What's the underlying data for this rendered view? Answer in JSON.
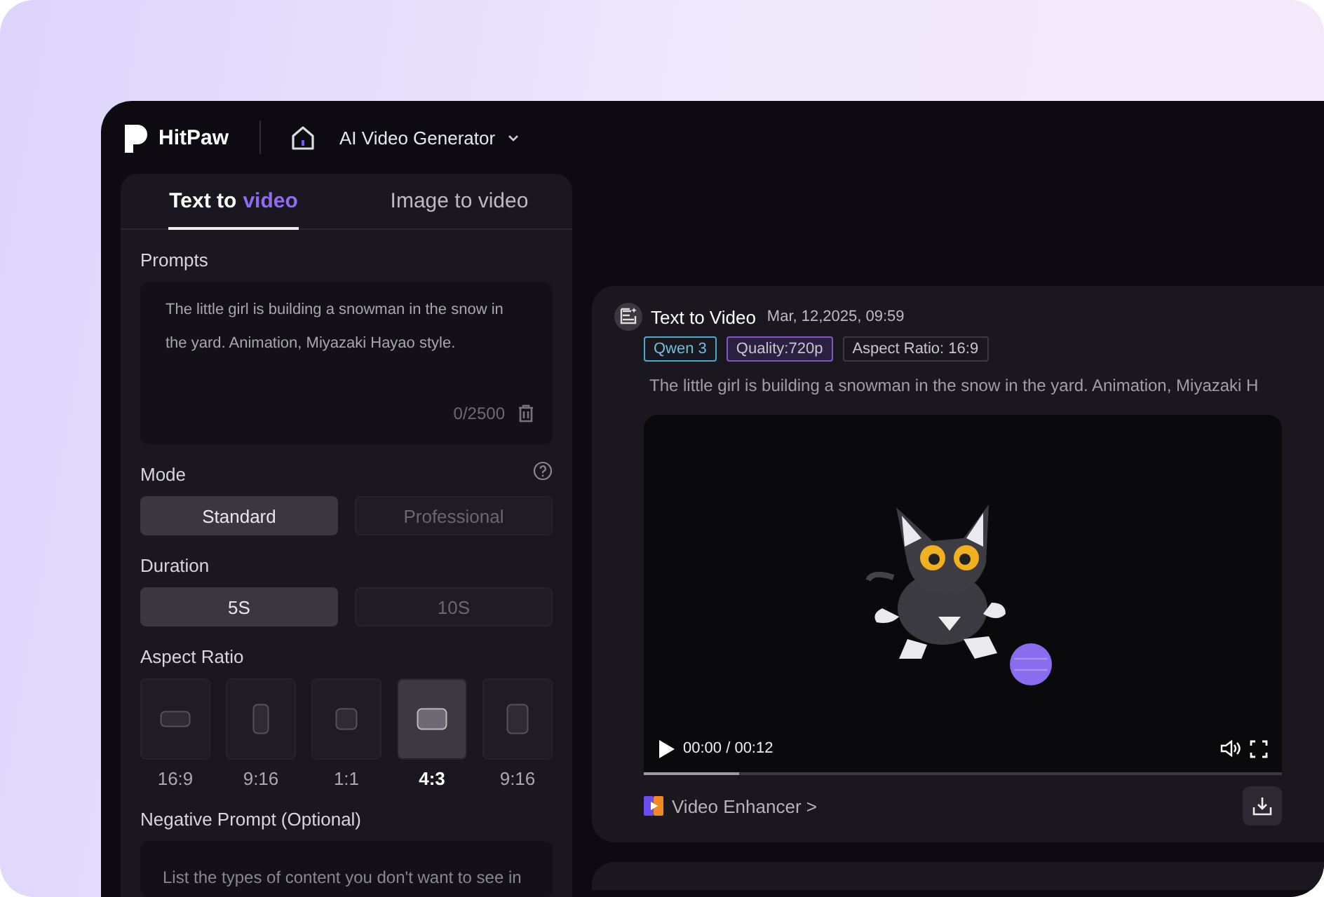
{
  "header": {
    "brand": "HitPaw",
    "app_menu": "AI Video Generator"
  },
  "tabs": [
    {
      "label": "Text to",
      "accent": "video",
      "selected": true
    },
    {
      "label": "Image to video",
      "selected": false
    }
  ],
  "prompts": {
    "label": "Prompts",
    "value": "The little girl is building a snowman in the snow in the yard. Animation, Miyazaki Hayao style.",
    "counter": "0/2500"
  },
  "mode": {
    "label": "Mode",
    "options": [
      {
        "label": "Standard",
        "selected": true
      },
      {
        "label": "Professional",
        "selected": false
      }
    ]
  },
  "duration": {
    "label": "Duration",
    "options": [
      {
        "label": "5S",
        "selected": true
      },
      {
        "label": "10S",
        "selected": false
      }
    ]
  },
  "aspect_ratio": {
    "label": "Aspect Ratio",
    "options": [
      {
        "label": "16:9",
        "kind": "wide",
        "selected": false
      },
      {
        "label": "9:16",
        "kind": "tall",
        "selected": false
      },
      {
        "label": "1:1",
        "kind": "square",
        "selected": false
      },
      {
        "label": "4:3",
        "kind": "standard",
        "selected": true
      },
      {
        "label": "9:16",
        "kind": "portrait",
        "selected": false
      }
    ]
  },
  "negative_prompt": {
    "label": "Negative Prompt (Optional)",
    "placeholder": "List the types of content you don't want to see in"
  },
  "result": {
    "title": "Text to Video",
    "date": "Mar, 12,2025, 09:59",
    "tags": [
      {
        "label": "Qwen 3",
        "color": "#4aa8cc"
      },
      {
        "label": "Quality:720p",
        "color": "#7e56c8"
      },
      {
        "label": "Aspect Ratio: 16:9",
        "color": "#3a3740"
      }
    ],
    "description": "The little girl is building a snowman in the snow in the yard. Animation, Miyazaki H",
    "player": {
      "time": "00:00 / 00:12",
      "level": 0.15
    },
    "enhancer_link": "Video Enhancer >"
  }
}
